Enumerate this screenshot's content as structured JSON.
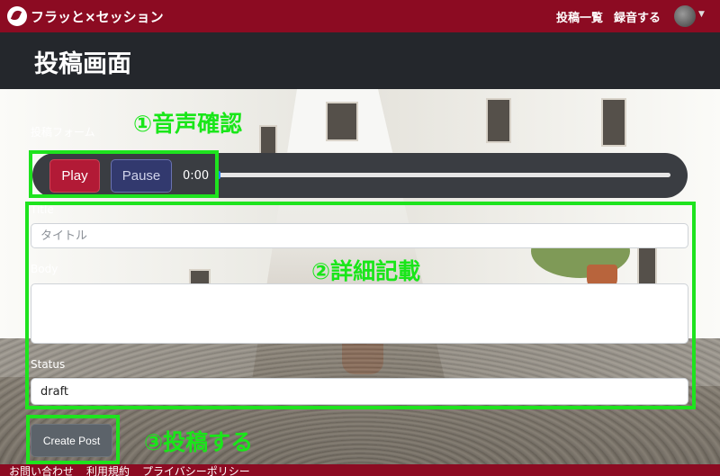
{
  "navbar": {
    "brand": "フラッと×セッション",
    "links": [
      "投稿一覧",
      "録音する"
    ]
  },
  "header": {
    "title": "投稿画面"
  },
  "form": {
    "label": "投稿フォーム",
    "player": {
      "play_label": "Play",
      "pause_label": "Pause",
      "time": "0:00",
      "progress": 0
    },
    "title": {
      "label": "Title",
      "placeholder": "タイトル",
      "value": ""
    },
    "body": {
      "label": "Body",
      "value": ""
    },
    "status": {
      "label": "Status",
      "value": "draft"
    },
    "submit_label": "Create Post"
  },
  "annotations": {
    "step1": "①音声確認",
    "step2": "②詳細記載",
    "step3": "③投稿する",
    "highlight_color": "#1EE31E"
  },
  "footer": {
    "links": [
      "お問い合わせ",
      "利用規約",
      "プライバシーポリシー"
    ]
  },
  "colors": {
    "navbar": "#8C0B22",
    "header": "#24272C",
    "play": "#B21A36",
    "pause": "#32396E"
  }
}
